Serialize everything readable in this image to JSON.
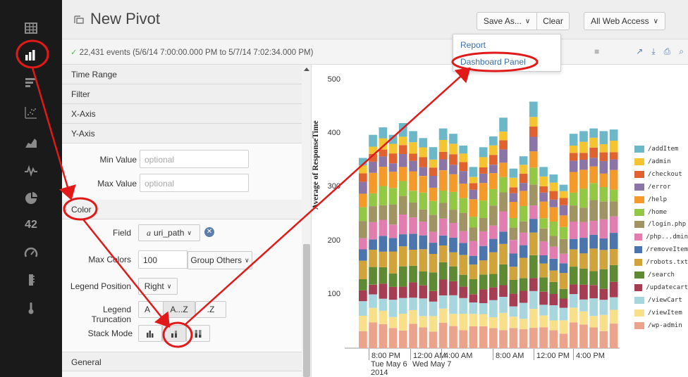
{
  "header": {
    "title": "New Pivot",
    "save_as": "Save As...",
    "clear": "Clear",
    "app_select": "All Web Access"
  },
  "subheader": {
    "events": "22,431 events (5/6/14 7:00:00.000 PM to 5/7/14 7:02:34.000 PM)"
  },
  "save_menu": {
    "items": [
      "Report",
      "Dashboard Panel"
    ]
  },
  "rail": {
    "items": [
      "table-icon",
      "column-chart-icon",
      "bar-chart-icon",
      "scatter-chart-icon",
      "area-chart-icon",
      "line-chart-icon",
      "pie-chart-icon",
      "single-value-icon",
      "radial-gauge-icon",
      "filler-gauge-icon",
      "marker-gauge-icon"
    ],
    "single_value_label": "42"
  },
  "panel": {
    "time_range": "Time Range",
    "filter": "Filter",
    "x_axis": "X-Axis",
    "y_axis": "Y-Axis",
    "min_value_label": "Min Value",
    "min_value_placeholder": "optional",
    "max_value_label": "Max Value",
    "max_value_placeholder": "optional",
    "color": "Color",
    "field_label": "Field",
    "field_value": "uri_path",
    "field_type_glyph": "a",
    "max_colors_label": "Max Colors",
    "max_colors_value": "100",
    "group_others": "Group Others",
    "legend_position_label": "Legend Position",
    "legend_position_value": "Right",
    "legend_truncation_label": "Legend Truncation",
    "legend_truncation_options": [
      "A...",
      "A...Z",
      "...Z"
    ],
    "legend_truncation_visible": [
      "A",
      "A...Z",
      ".Z"
    ],
    "stack_mode_label": "Stack Mode",
    "general": "General"
  },
  "chart_data": {
    "type": "bar",
    "stacked": true,
    "ylabel": "Average of ResponseTime",
    "ylim": [
      0,
      500
    ],
    "yticks": [
      "500",
      "400",
      "300",
      "200",
      "100"
    ],
    "xticks": [
      {
        "label": "8:00 PM",
        "sub": [
          "Tue May 6",
          "2014"
        ]
      },
      {
        "label": "12:00 AM",
        "sub": [
          "Wed May 7"
        ]
      },
      {
        "label": "4:00 AM",
        "sub": []
      },
      {
        "label": "8:00 AM",
        "sub": []
      },
      {
        "label": "12:00 PM",
        "sub": []
      },
      {
        "label": "4:00 PM",
        "sub": []
      }
    ],
    "legend_position": "right",
    "series": [
      {
        "name": "/addItem",
        "color": "#6cb8c9"
      },
      {
        "name": "/admin",
        "color": "#f5c431"
      },
      {
        "name": "/checkout",
        "color": "#e0632f"
      },
      {
        "name": "/error",
        "color": "#8a75a6"
      },
      {
        "name": "/help",
        "color": "#f39a2b"
      },
      {
        "name": "/home",
        "color": "#93c844"
      },
      {
        "name": "/login.php",
        "color": "#a09364"
      },
      {
        "name": "/php...dmin",
        "color": "#e27db0"
      },
      {
        "name": "/removeItem",
        "color": "#4c74ad"
      },
      {
        "name": "/robots.txt",
        "color": "#d1a33b"
      },
      {
        "name": "/search",
        "color": "#5f8a34"
      },
      {
        "name": "/updatecart",
        "color": "#a53d53"
      },
      {
        "name": "/viewCart",
        "color": "#a8d6df"
      },
      {
        "name": "/viewItem",
        "color": "#f8e08a"
      },
      {
        "name": "/wp-admin",
        "color": "#eba38c"
      }
    ],
    "totals": [
      355,
      398,
      412,
      398,
      420,
      405,
      392,
      375,
      410,
      400,
      378,
      338,
      375,
      395,
      430,
      335,
      358,
      460,
      338,
      324,
      305,
      400,
      405,
      410,
      405,
      408
    ]
  },
  "colors": {
    "annotation": "#e11919",
    "link": "#3a6fa8"
  }
}
